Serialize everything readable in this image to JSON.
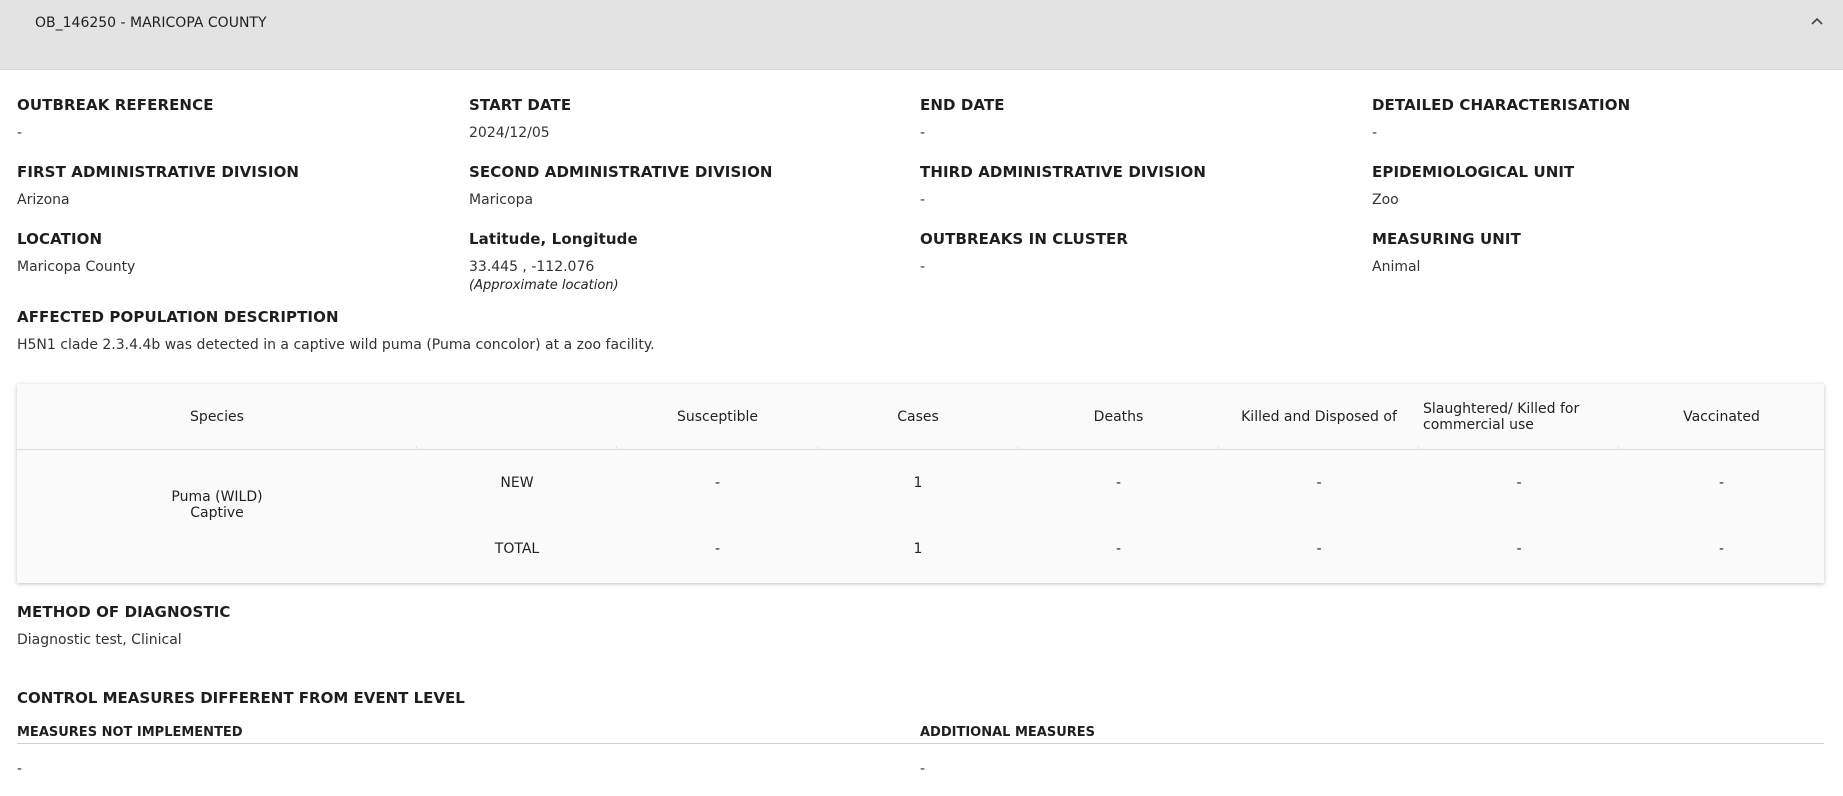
{
  "header": {
    "title": "OB_146250 - MARICOPA COUNTY"
  },
  "fields": {
    "outbreak_reference": {
      "label": "OUTBREAK REFERENCE",
      "value": "-"
    },
    "start_date": {
      "label": "START DATE",
      "value": "2024/12/05"
    },
    "end_date": {
      "label": "END DATE",
      "value": "-"
    },
    "detailed_characterisation": {
      "label": "DETAILED CHARACTERISATION",
      "value": "-"
    },
    "first_admin_division": {
      "label": "FIRST ADMINISTRATIVE DIVISION",
      "value": "Arizona"
    },
    "second_admin_division": {
      "label": "SECOND ADMINISTRATIVE DIVISION",
      "value": "Maricopa"
    },
    "third_admin_division": {
      "label": "THIRD ADMINISTRATIVE DIVISION",
      "value": "-"
    },
    "epidemiological_unit": {
      "label": "EPIDEMIOLOGICAL UNIT",
      "value": "Zoo"
    },
    "location": {
      "label": "LOCATION",
      "value": "Maricopa County"
    },
    "lat_long": {
      "label": "Latitude, Longitude",
      "value": "33.445 , -112.076",
      "note": "(Approximate location)"
    },
    "outbreaks_in_cluster": {
      "label": "OUTBREAKS IN CLUSTER",
      "value": "-"
    },
    "measuring_unit": {
      "label": "MEASURING UNIT",
      "value": "Animal"
    }
  },
  "affected_population": {
    "label": "AFFECTED POPULATION DESCRIPTION",
    "value": "H5N1 clade 2.3.4.4b was detected in a captive wild puma (Puma concolor) at a zoo facility."
  },
  "table": {
    "headers": {
      "species": "Species",
      "susceptible": "Susceptible",
      "cases": "Cases",
      "deaths": "Deaths",
      "killed_disposed": "Killed and Disposed of",
      "slaughtered": "Slaughtered/ Killed for commercial use",
      "vaccinated": "Vaccinated"
    },
    "species_name": "Puma (WILD)",
    "species_status": "Captive",
    "rows": [
      {
        "label": "NEW",
        "susceptible": "-",
        "cases": "1",
        "deaths": "-",
        "killed_disposed": "-",
        "slaughtered": "-",
        "vaccinated": "-"
      },
      {
        "label": "TOTAL",
        "susceptible": "-",
        "cases": "1",
        "deaths": "-",
        "killed_disposed": "-",
        "slaughtered": "-",
        "vaccinated": "-"
      }
    ]
  },
  "method_of_diagnostic": {
    "label": "METHOD OF DIAGNOSTIC",
    "value": "Diagnostic test, Clinical"
  },
  "control_measures": {
    "title": "CONTROL MEASURES DIFFERENT FROM EVENT LEVEL",
    "not_implemented_label": "MEASURES NOT IMPLEMENTED",
    "not_implemented_value": "-",
    "additional_label": "ADDITIONAL MEASURES",
    "additional_value": "-"
  }
}
